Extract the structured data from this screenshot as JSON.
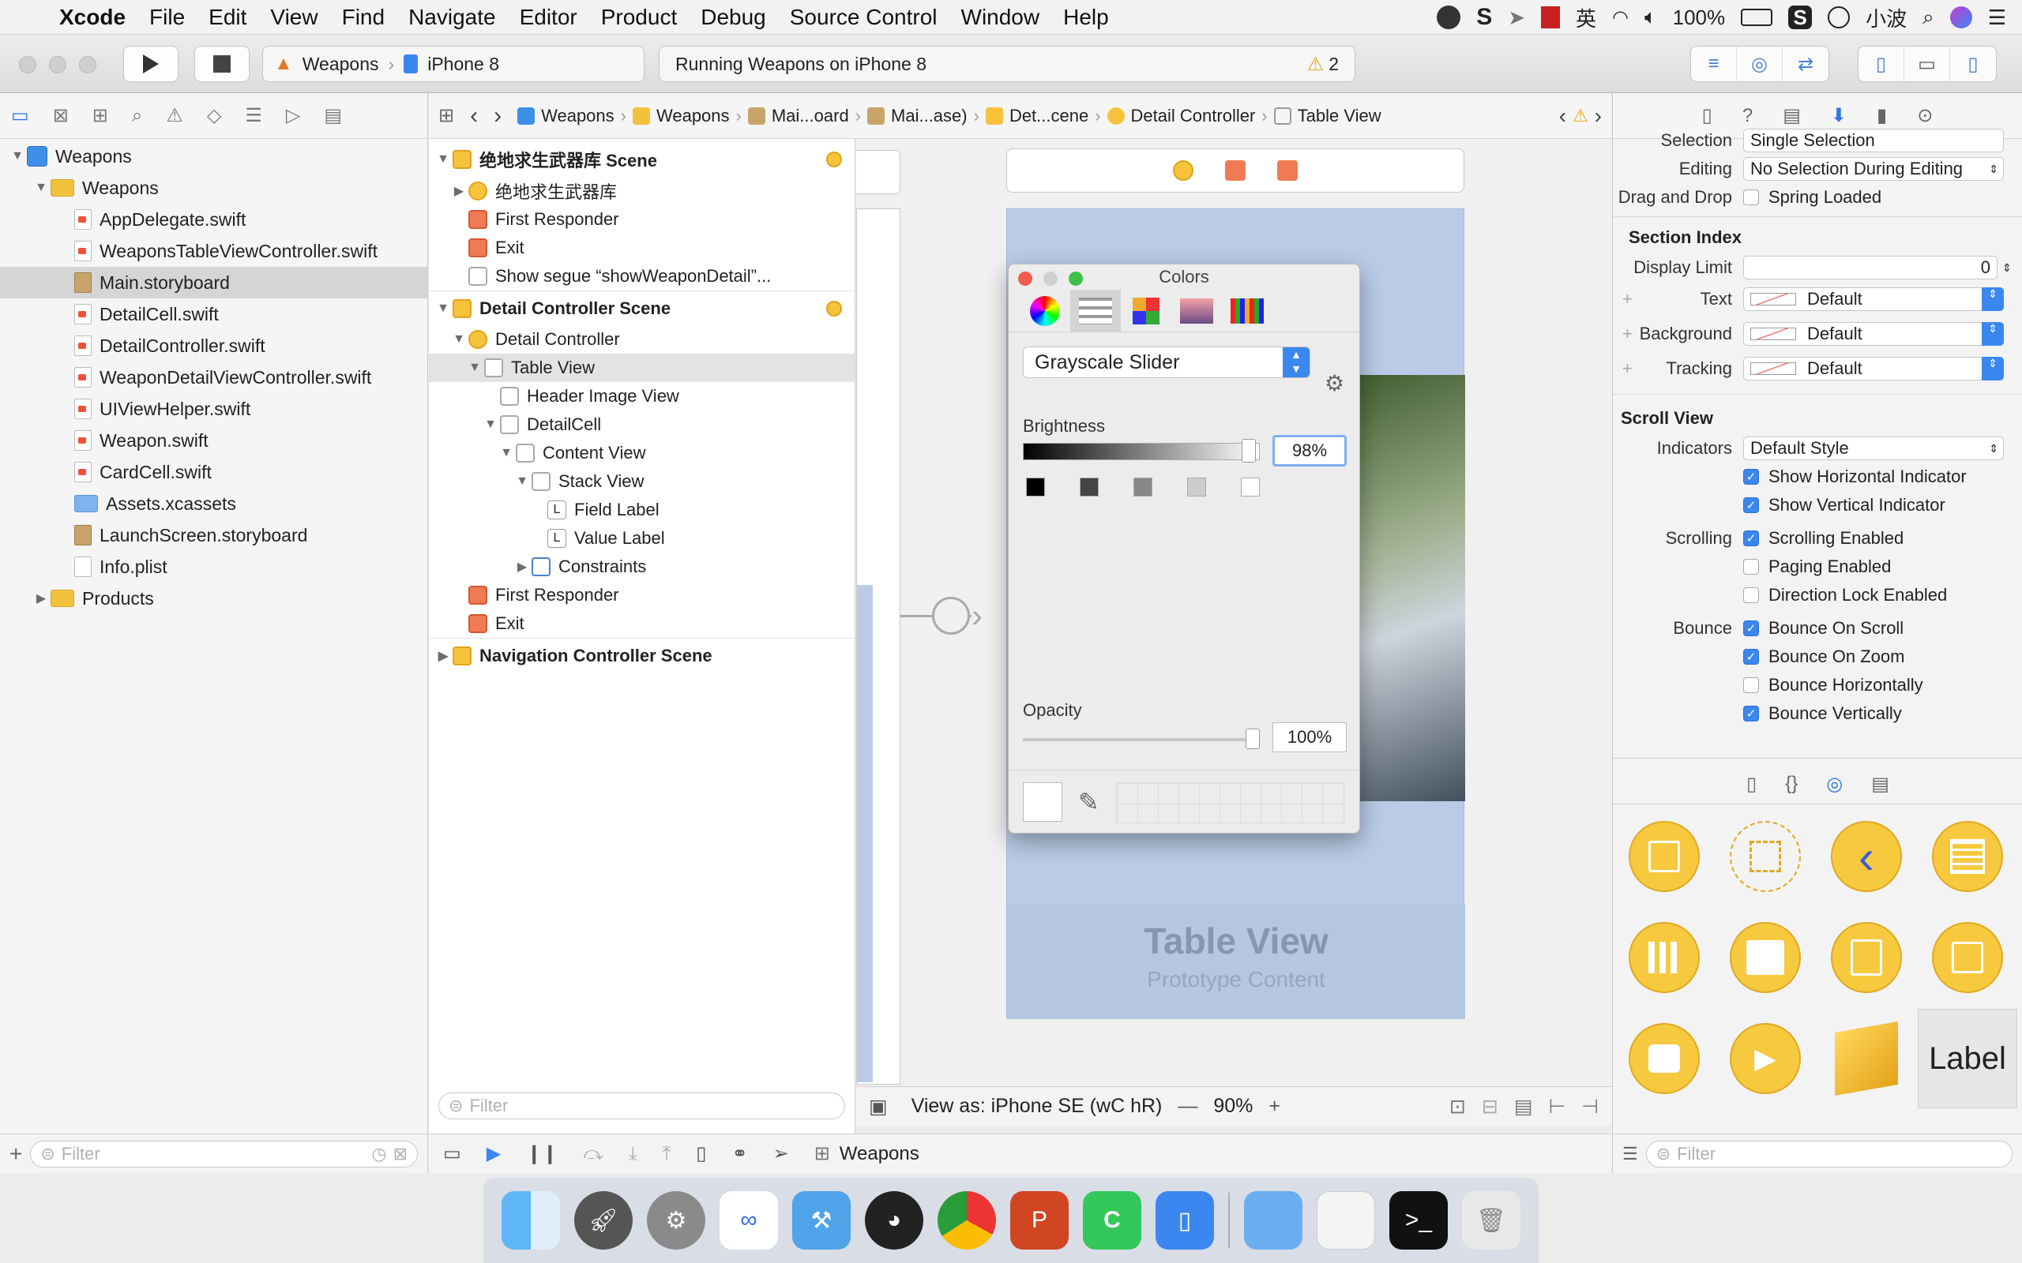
{
  "menubar": {
    "app": "Xcode",
    "items": [
      "File",
      "Edit",
      "View",
      "Find",
      "Navigate",
      "Editor",
      "Product",
      "Debug",
      "Source Control",
      "Window",
      "Help"
    ],
    "battery": "100%",
    "ime": "英",
    "user": "小波"
  },
  "toolbar": {
    "scheme": "Weapons",
    "device": "iPhone 8",
    "status": "Running Weapons on iPhone 8",
    "warnings": "2"
  },
  "navigator": {
    "items": [
      {
        "label": "Weapons",
        "level": 0,
        "tri": "▼",
        "icon": "proj"
      },
      {
        "label": "Weapons",
        "level": 1,
        "tri": "▼",
        "icon": "folder"
      },
      {
        "label": "AppDelegate.swift",
        "level": 2,
        "icon": "swift"
      },
      {
        "label": "WeaponsTableViewController.swift",
        "level": 2,
        "icon": "swift"
      },
      {
        "label": "Main.storyboard",
        "level": 2,
        "icon": "sb",
        "selected": true
      },
      {
        "label": "DetailCell.swift",
        "level": 2,
        "icon": "swift"
      },
      {
        "label": "DetailController.swift",
        "level": 2,
        "icon": "swift"
      },
      {
        "label": "WeaponDetailViewController.swift",
        "level": 2,
        "icon": "swift"
      },
      {
        "label": "UIViewHelper.swift",
        "level": 2,
        "icon": "swift"
      },
      {
        "label": "Weapon.swift",
        "level": 2,
        "icon": "swift"
      },
      {
        "label": "CardCell.swift",
        "level": 2,
        "icon": "swift"
      },
      {
        "label": "Assets.xcassets",
        "level": 2,
        "icon": "blue"
      },
      {
        "label": "LaunchScreen.storyboard",
        "level": 2,
        "icon": "sb"
      },
      {
        "label": "Info.plist",
        "level": 2,
        "icon": "plist"
      },
      {
        "label": "Products",
        "level": 1,
        "tri": "▶",
        "icon": "folder"
      }
    ],
    "filter_placeholder": "Filter"
  },
  "jumpbar": [
    "Weapons",
    "Weapons",
    "Mai...oard",
    "Mai...ase)",
    "Det...cene",
    "Detail Controller",
    "Table View"
  ],
  "outline": {
    "items": [
      {
        "label": "绝地求生武器库 Scene",
        "level": 0,
        "tri": "▼",
        "icon": "y",
        "scene": true,
        "dot": true
      },
      {
        "label": "绝地求生武器库",
        "level": 1,
        "tri": "▶",
        "icon": "yc"
      },
      {
        "label": "First Responder",
        "level": 1,
        "icon": "r"
      },
      {
        "label": "Exit",
        "level": 1,
        "icon": "r"
      },
      {
        "label": "Show segue “showWeaponDetail”...",
        "level": 1,
        "icon": "g"
      },
      {
        "label": "Detail Controller Scene",
        "level": 0,
        "tri": "▼",
        "icon": "y",
        "scene": true,
        "dot": true
      },
      {
        "label": "Detail Controller",
        "level": 1,
        "tri": "▼",
        "icon": "yc"
      },
      {
        "label": "Table View",
        "level": 2,
        "tri": "▼",
        "icon": "g",
        "selected": true
      },
      {
        "label": "Header Image View",
        "level": 3,
        "icon": "g"
      },
      {
        "label": "DetailCell",
        "level": 3,
        "tri": "▼",
        "icon": "g"
      },
      {
        "label": "Content View",
        "level": 4,
        "tri": "▼",
        "icon": "g"
      },
      {
        "label": "Stack View",
        "level": 5,
        "tri": "▼",
        "icon": "g"
      },
      {
        "label": "Field Label",
        "level": 6,
        "icon": "L"
      },
      {
        "label": "Value Label",
        "level": 6,
        "icon": "L"
      },
      {
        "label": "Constraints",
        "level": 5,
        "tri": "▶",
        "icon": "b"
      },
      {
        "label": "First Responder",
        "level": 1,
        "icon": "r"
      },
      {
        "label": "Exit",
        "level": 1,
        "icon": "r"
      },
      {
        "label": "Navigation Controller Scene",
        "level": 0,
        "tri": "▶",
        "icon": "y",
        "scene": true
      }
    ],
    "filter_placeholder": "Filter"
  },
  "canvas": {
    "table_view_title": "Table View",
    "prototype_label": "Prototype Content",
    "view_as": "View as: iPhone SE (wC hR)",
    "zoom": "90%"
  },
  "colors_panel": {
    "title": "Colors",
    "mode": "Grayscale Slider",
    "brightness_label": "Brightness",
    "brightness_value": "98%",
    "brightness": 0.98,
    "opacity_label": "Opacity",
    "opacity_value": "100%",
    "opacity": 1.0,
    "swatches": [
      "#000000",
      "#444444",
      "#888888",
      "#cccccc",
      "#ffffff"
    ]
  },
  "inspector": {
    "selection_label": "Selection",
    "selection_value": "Single Selection",
    "editing_label": "Editing",
    "editing_value": "No Selection During Editing",
    "dragdrop_label": "Drag and Drop",
    "dragdrop_value": "Spring Loaded",
    "section_index": "Section Index",
    "display_limit_label": "Display Limit",
    "display_limit_value": "0",
    "text_label": "Text",
    "background_label": "Background",
    "tracking_label": "Tracking",
    "default_value": "Default",
    "scroll_view": "Scroll View",
    "indicators_label": "Indicators",
    "indicators_value": "Default Style",
    "scrolling_label": "Scrolling",
    "bounce_label": "Bounce",
    "checks": [
      {
        "label": "Show Horizontal Indicator",
        "on": true
      },
      {
        "label": "Show Vertical Indicator",
        "on": true
      },
      {
        "label": "Scrolling Enabled",
        "on": true
      },
      {
        "label": "Paging Enabled",
        "on": false
      },
      {
        "label": "Direction Lock Enabled",
        "on": false
      },
      {
        "label": "Bounce On Scroll",
        "on": true
      },
      {
        "label": "Bounce On Zoom",
        "on": true
      },
      {
        "label": "Bounce Horizontally",
        "on": false
      },
      {
        "label": "Bounce Vertically",
        "on": true
      }
    ],
    "library_label_tile": "Label",
    "filter_placeholder": "Filter"
  },
  "debugbar": {
    "target": "Weapons"
  },
  "colors": {
    "accent": "#3b87f0",
    "selection": "#d5d5d5",
    "canvas_blue": "#b9cbe6"
  }
}
